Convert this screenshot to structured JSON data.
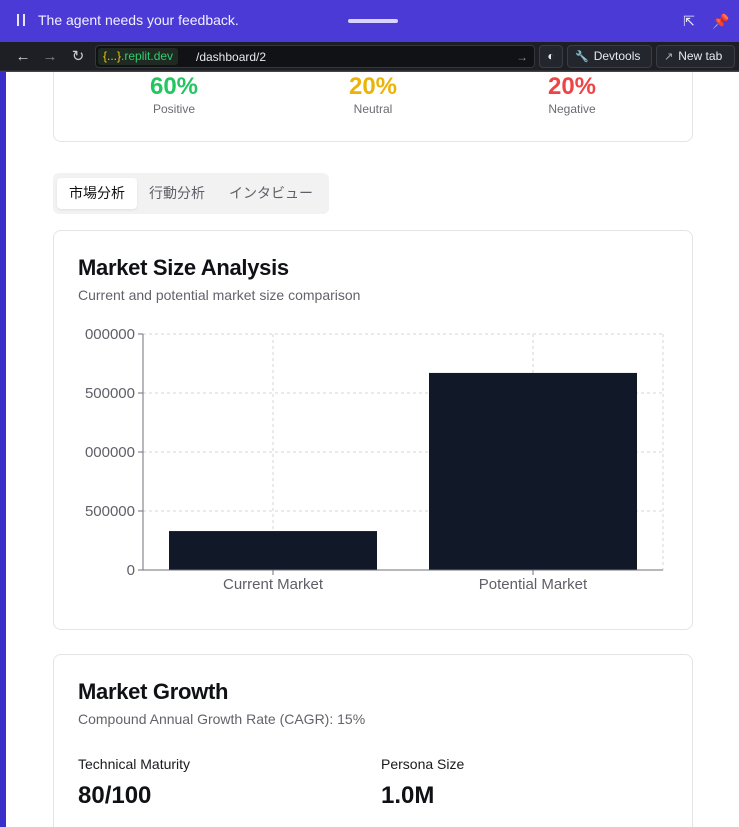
{
  "agent_bar": {
    "message": "The agent needs your feedback."
  },
  "browser": {
    "host_prefix": "{...}",
    "host_suffix": ".replit.dev",
    "path": "/dashboard/2",
    "devtools_label": "Devtools",
    "newtab_label": "New tab"
  },
  "sentiment": [
    {
      "value": "60%",
      "label": "Positive",
      "color": "#22c55e"
    },
    {
      "value": "20%",
      "label": "Neutral",
      "color": "#eab308"
    },
    {
      "value": "20%",
      "label": "Negative",
      "color": "#ef4444"
    }
  ],
  "tabs": [
    {
      "label": "市場分析",
      "active": true
    },
    {
      "label": "行動分析",
      "active": false
    },
    {
      "label": "インタビュー",
      "active": false
    }
  ],
  "market_size": {
    "title": "Market Size Analysis",
    "subtitle": "Current and potential market size comparison"
  },
  "chart_data": {
    "type": "bar",
    "categories": [
      "Current Market",
      "Potential Market"
    ],
    "values": [
      330000,
      1670000
    ],
    "ylim": [
      0,
      2000000
    ],
    "yticks": [
      0,
      500000,
      1000000,
      1500000,
      2000000
    ],
    "ytick_labels": [
      "0",
      "500000",
      "000000",
      "500000",
      "000000"
    ],
    "grid": true,
    "bar_color": "#111827"
  },
  "market_growth": {
    "title": "Market Growth",
    "subtitle": "Compound Annual Growth Rate (CAGR): 15%",
    "stats": [
      {
        "label": "Technical Maturity",
        "value": "80/100"
      },
      {
        "label": "Persona Size",
        "value": "1.0M"
      }
    ]
  }
}
